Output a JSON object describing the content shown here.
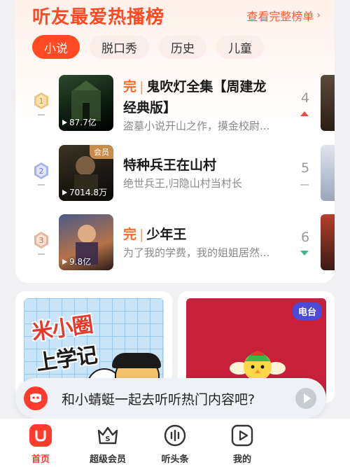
{
  "ranking": {
    "title": "听友最爱热播榜",
    "see_all": "查看完整榜单",
    "tabs": [
      "小说",
      "脱口秀",
      "历史",
      "儿童"
    ],
    "active_tab": "小说",
    "items": [
      {
        "rank": "1",
        "done_label": "完",
        "title_line1": "鬼吹灯全集【周建龙",
        "title_line2": "经典版】",
        "desc": "盗墓小说开山之作，摸金校尉...",
        "plays": "87.7亿",
        "side_rank": "4",
        "trend": "up",
        "colors": {
          "medal": "#f2c37a"
        }
      },
      {
        "rank": "2",
        "vip_label": "会员",
        "title_line1": "特种兵王在山村",
        "desc": "绝世兵王,归隐山村当村长",
        "plays": "7014.8万",
        "side_rank": "5",
        "trend": "flat",
        "colors": {
          "medal": "#a8b4e6"
        }
      },
      {
        "rank": "3",
        "done_label": "完",
        "title_line1": "少年王",
        "desc": "为了我的学费，我的姐姐居然...",
        "plays": "9.8亿",
        "side_rank": "6",
        "trend": "down",
        "colors": {
          "medal": "#e8b49c"
        }
      }
    ]
  },
  "cards": {
    "left": {
      "title_main": "米小圈",
      "title_sub": "上学记"
    },
    "right": {
      "badge": "电台"
    }
  },
  "assistant": {
    "message": "和小蜻蜓一起去听听热门内容吧?"
  },
  "nav": [
    {
      "label": "首页",
      "icon": "home-icon",
      "active": true
    },
    {
      "label": "超级会员",
      "icon": "vip-crown-icon",
      "active": false
    },
    {
      "label": "听头条",
      "icon": "headline-icon",
      "active": false
    },
    {
      "label": "我的",
      "icon": "profile-icon",
      "active": false
    }
  ],
  "colors": {
    "accent": "#ff4a24",
    "trend_up": "#e84a4a",
    "trend_down": "#3bb88c",
    "radio_bg": "#c81f3a",
    "radio_badge": "#4b4bd8"
  }
}
